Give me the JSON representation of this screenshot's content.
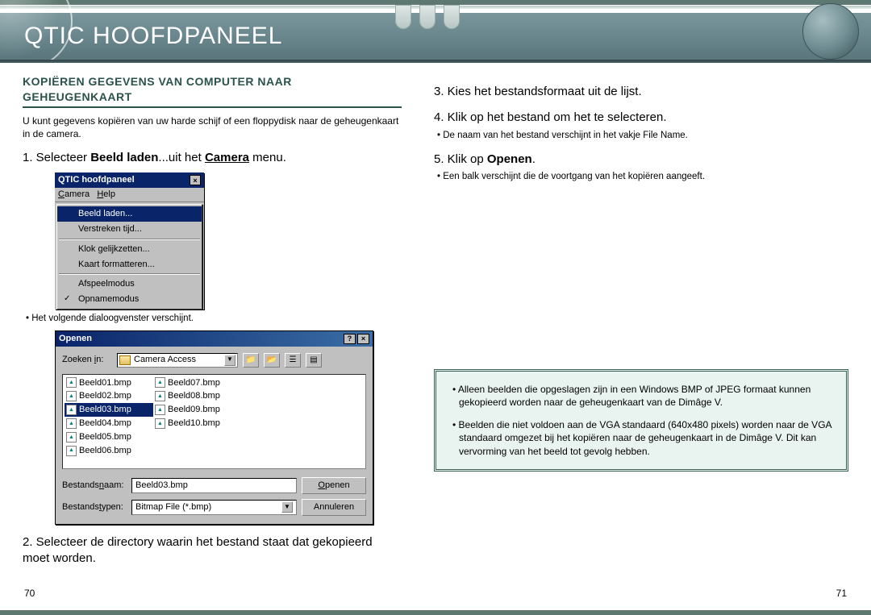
{
  "banner": {
    "title": "QTIC HOOFDPANEEL"
  },
  "left": {
    "heading": "KOPIËREN GEGEVENS VAN COMPUTER NAAR GEHEUGENKAART",
    "intro": "U kunt gegevens kopiëren van uw harde schijf of een floppydisk naar de geheugenkaart in de camera.",
    "step1_pre": "1. Selecteer ",
    "step1_b1": "Beeld laden",
    "step1_mid": "...uit het ",
    "step1_b2": "Camera",
    "step1_post": " menu.",
    "menu": {
      "title": "QTIC hoofdpaneel",
      "menubar_camera": "Camera",
      "menubar_help": "Help",
      "items": [
        "Beeld laden...",
        "Verstreken tijd...",
        "Klok gelijkzetten...",
        "Kaart formatteren...",
        "Afspeelmodus",
        "Opnamemodus"
      ]
    },
    "after_menu_bullet": "Het volgende dialoogvenster verschijnt.",
    "dialog": {
      "title": "Openen",
      "lookin_label": "Zoeken in:",
      "lookin_value": "Camera Access",
      "files": [
        "Beeld01.bmp",
        "Beeld02.bmp",
        "Beeld03.bmp",
        "Beeld04.bmp",
        "Beeld05.bmp",
        "Beeld06.bmp",
        "Beeld07.bmp",
        "Beeld08.bmp",
        "Beeld09.bmp",
        "Beeld10.bmp"
      ],
      "selected_file": "Beeld03.bmp",
      "filename_label": "Bestandsnaam:",
      "filename_value": "Beeld03.bmp",
      "filetype_label": "Bestandstypen:",
      "filetype_value": "Bitmap File (*.bmp)",
      "open_btn": "Openen",
      "cancel_btn": "Annuleren"
    },
    "step2": "2. Selecteer de directory waarin het bestand staat dat gekopieerd moet worden."
  },
  "right": {
    "step3": "3. Kies het bestandsformaat uit de lijst.",
    "step4": "4. Klik op het bestand om het te selecteren.",
    "step4_bullet": "De naam van het bestand verschijnt in het vakje File Name.",
    "step5_pre": "5. Klik op ",
    "step5_b": "Openen",
    "step5_post": ".",
    "step5_bullet": "Een balk verschijnt die de voortgang van het kopiëren aangeeft.",
    "note1": "Alleen beelden die opgeslagen zijn in een Windows BMP of JPEG formaat kunnen gekopieerd worden naar de geheugenkaart van de Dimâge V.",
    "note2": "Beelden die niet voldoen aan de VGA standaard (640x480 pixels) worden naar de VGA standaard omgezet bij het kopiëren naar de geheugenkaart in de Dimâge V. Dit kan vervorming van het beeld tot gevolg hebben."
  },
  "pagenum_left": "70",
  "pagenum_right": "71"
}
